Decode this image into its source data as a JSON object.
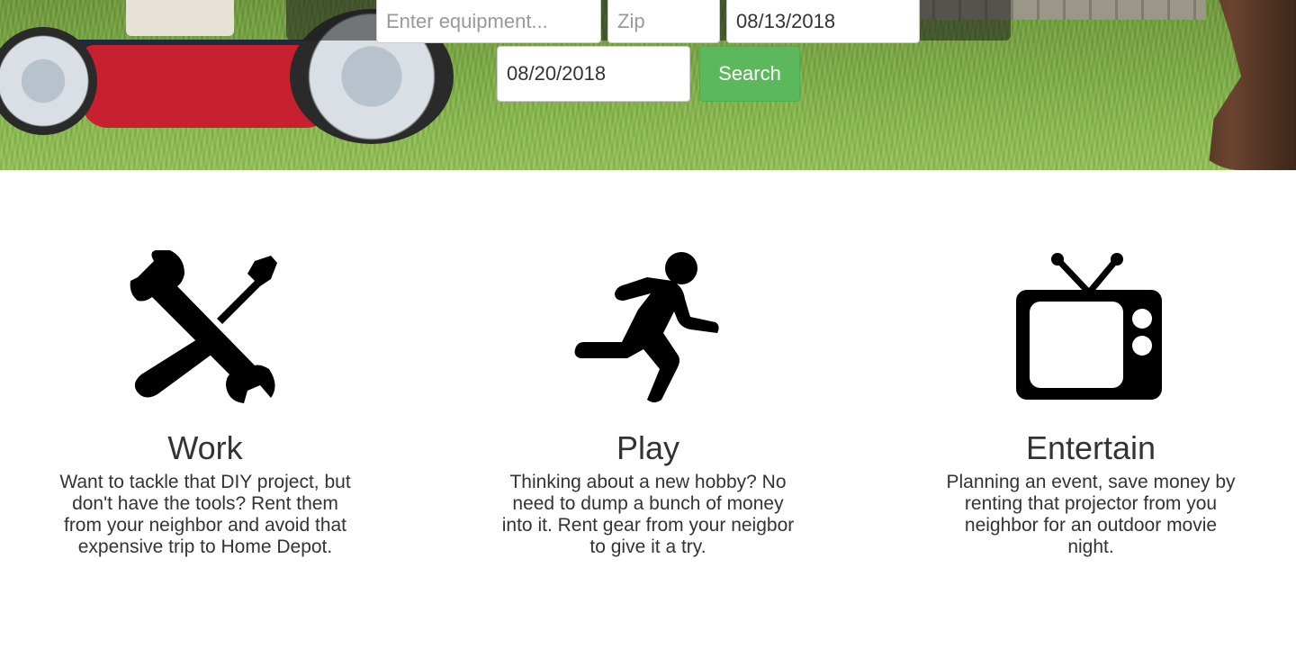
{
  "search": {
    "equipment_placeholder": "Enter equipment...",
    "zip_placeholder": "Zip",
    "start_date": "08/13/2018",
    "end_date": "08/20/2018",
    "button_label": "Search"
  },
  "colors": {
    "search_button": "#5cb85c",
    "text": "#333333",
    "icon": "#000000"
  },
  "features": [
    {
      "title": "Work",
      "icon": "tools-icon",
      "description": "Want to tackle that DIY project, but don't have the tools? Rent them from your neighbor and avoid that expensive trip to Home Depot."
    },
    {
      "title": "Play",
      "icon": "running-person-icon",
      "description": "Thinking about a new hobby? No need to dump a bunch of money into it. Rent gear from your neigbor to give it a try."
    },
    {
      "title": "Entertain",
      "icon": "tv-icon",
      "description": "Planning an event, save money by renting that projector from you neighbor for an outdoor movie night."
    }
  ]
}
